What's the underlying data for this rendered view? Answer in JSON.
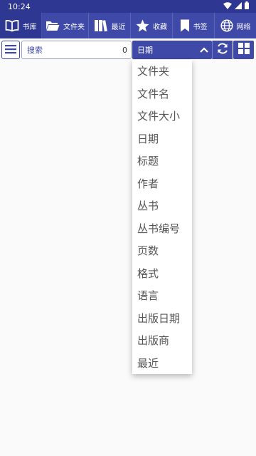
{
  "status": {
    "time": "10:24"
  },
  "tabs": [
    {
      "label": "书库",
      "icon": "open-book-icon",
      "active": true
    },
    {
      "label": "文件夹",
      "icon": "folder-icon",
      "active": false
    },
    {
      "label": "最近",
      "icon": "books-icon",
      "active": false
    },
    {
      "label": "收藏",
      "icon": "star-icon",
      "active": false
    },
    {
      "label": "书签",
      "icon": "bookmark-icon",
      "active": false
    },
    {
      "label": "网络",
      "icon": "globe-icon",
      "active": false
    }
  ],
  "toolbar": {
    "search_label": "搜索",
    "search_count": "0",
    "sort_selected": "日期"
  },
  "sort_options": [
    "文件夹",
    "文件名",
    "文件大小",
    "日期",
    "标题",
    "作者",
    "丛书",
    "丛书编号",
    "页数",
    "格式",
    "语言",
    "出版日期",
    "出版商",
    "最近"
  ],
  "colors": {
    "primary": "#3f4aa8",
    "primary_dark": "#2e3893",
    "background": "#fafafa"
  }
}
